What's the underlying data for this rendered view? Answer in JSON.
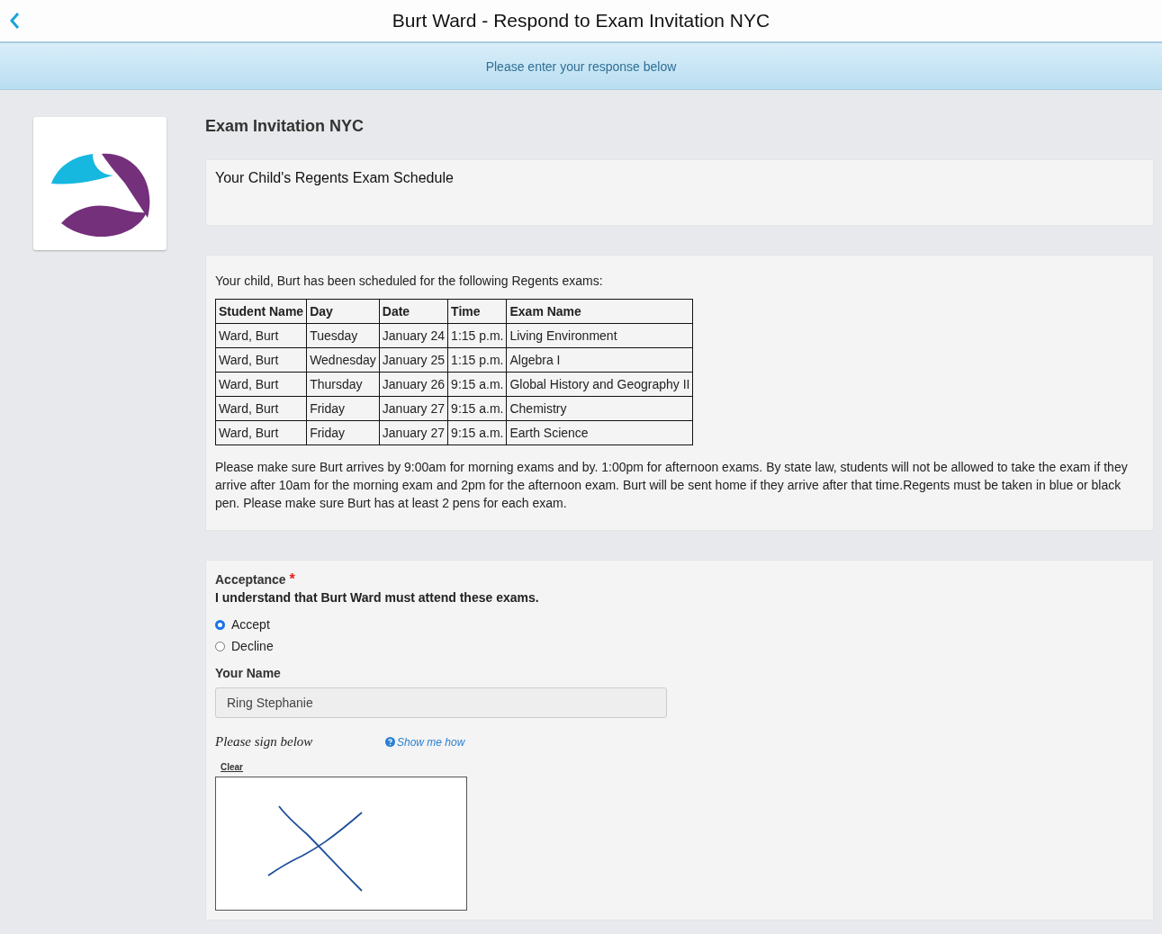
{
  "header": {
    "title": "Burt Ward - Respond to Exam Invitation NYC"
  },
  "banner": {
    "text": "Please enter your response below"
  },
  "form": {
    "title": "Exam Invitation NYC",
    "schedule_heading": "Your Child's Regents Exam Schedule",
    "intro": "Your child, Burt has been scheduled for the following Regents exams:",
    "table": {
      "columns": [
        "Student Name",
        "Day",
        "Date",
        "Time",
        "Exam Name"
      ],
      "rows": [
        [
          "Ward, Burt",
          "Tuesday",
          "January 24",
          "1:15 p.m.",
          "Living Environment"
        ],
        [
          "Ward, Burt",
          "Wednesday",
          "January 25",
          "1:15 p.m.",
          "Algebra I"
        ],
        [
          "Ward, Burt",
          "Thursday",
          "January 26",
          "9:15 a.m.",
          "Global History and Geography II"
        ],
        [
          "Ward, Burt",
          "Friday",
          "January 27",
          "9:15 a.m.",
          "Chemistry"
        ],
        [
          "Ward, Burt",
          "Friday",
          "January 27",
          "9:15 a.m.",
          "Earth Science"
        ]
      ]
    },
    "notice": "Please make sure Burt arrives by 9:00am for morning exams and by. 1:00pm for afternoon exams. By state law, students will not be allowed to take the exam if they arrive after 10am for the morning exam and 2pm for the afternoon exam. Burt will be sent home if they arrive after that time.Regents must be taken in blue or black pen. Please make sure Burt has at least 2 pens for each exam.",
    "acceptance": {
      "label": "Acceptance",
      "required_mark": "*",
      "statement": "I understand that Burt Ward must attend these exams.",
      "options": [
        {
          "label": "Accept",
          "selected": true
        },
        {
          "label": "Decline",
          "selected": false
        }
      ]
    },
    "name_field": {
      "label": "Your Name",
      "value": "Ring Stephanie"
    },
    "signature": {
      "label": "Please sign below",
      "help_link": "Show me how",
      "clear": "Clear"
    }
  }
}
